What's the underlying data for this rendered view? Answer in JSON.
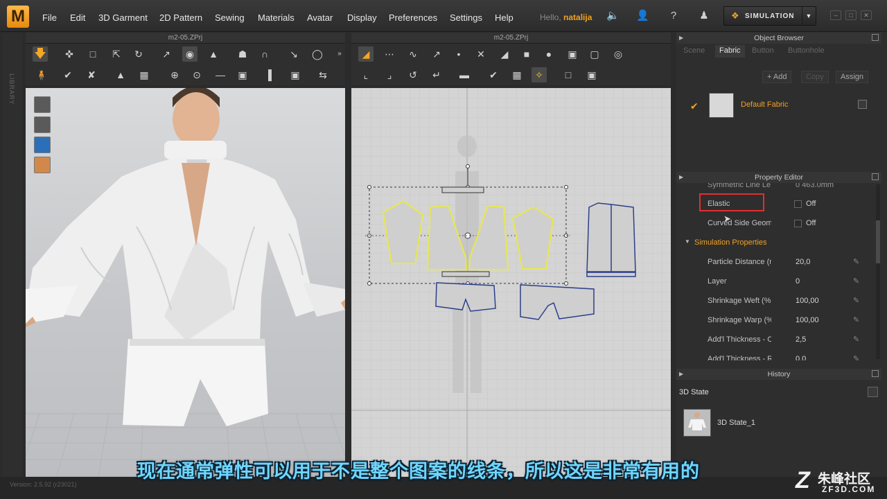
{
  "app": {
    "logo": "M"
  },
  "menu": [
    "File",
    "Edit",
    "3D Garment",
    "2D Pattern",
    "Sewing",
    "Materials",
    "Avatar",
    "Display",
    "Preferences",
    "Settings",
    "Help"
  ],
  "user": {
    "hello": "Hello,",
    "name": "natalija"
  },
  "simulation_button": "SIMULATION",
  "library_label": "LIBRARY",
  "view3d": {
    "title": "m2-05.ZPrj"
  },
  "view2d": {
    "title": "m2-05.ZPrj"
  },
  "object_browser": {
    "title": "Object Browser",
    "tabs": [
      "Scene",
      "Fabric",
      "Button",
      "Buttonhole"
    ],
    "active_tab": "Fabric",
    "buttons": {
      "add": "+ Add",
      "copy": "Copy",
      "assign": "Assign"
    },
    "fabric_item": "Default Fabric"
  },
  "property_editor": {
    "title": "Property Editor",
    "clipped_row": {
      "label": "Symmetric Line Le",
      "value": "0 463.0mm"
    },
    "elastic": {
      "label": "Elastic",
      "value": "Off"
    },
    "curved": {
      "label": "Curved Side Geome",
      "value": "Off"
    },
    "section": "Simulation Properties",
    "rows": [
      {
        "label": "Particle Distance (m",
        "value": "20,0"
      },
      {
        "label": "Layer",
        "value": "0"
      },
      {
        "label": "Shrinkage Weft (%",
        "value": "100,00"
      },
      {
        "label": "Shrinkage Warp (%",
        "value": "100,00"
      },
      {
        "label": "Add'l Thickness - Collisio",
        "value": "2,5"
      },
      {
        "label": "Add'l Thickness - Renderi",
        "value": "0,0"
      }
    ]
  },
  "history": {
    "title": "History",
    "state_header": "3D State",
    "item": "3D State_1"
  },
  "subtitle": "现在通常弹性可以用于不是整个图案的线条，所以这是非常有用的",
  "watermark": {
    "cn": "朱峰社区",
    "en": "ZF3D.COM",
    "z": "Z"
  },
  "version": "Version: 2.5.92     (r23021)",
  "colors": {
    "accent": "#f2a220",
    "highlight_box": "#e03030",
    "selected_pattern": "#e8e84a",
    "pattern_outline": "#2b3f8a"
  }
}
